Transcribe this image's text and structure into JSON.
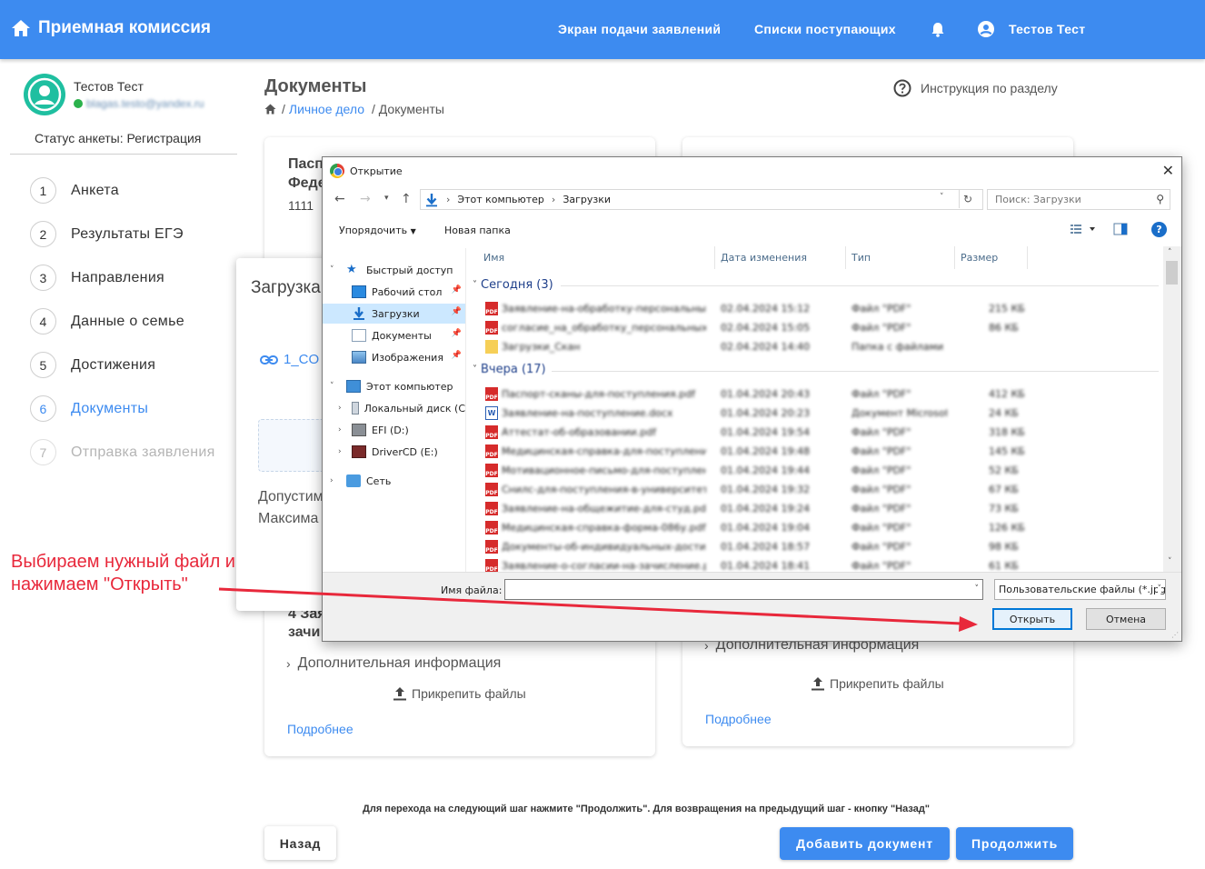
{
  "header": {
    "brand": "Приемная комиссия",
    "nav": [
      "Экран подачи заявлений",
      "Списки поступающих"
    ],
    "user": "Тестов Тест"
  },
  "sidebar": {
    "user_name": "Тестов Тест",
    "user_email": "blagas.testo@yandex.ru",
    "status": "Статус анкеты: Регистрация",
    "steps": [
      {
        "num": "1",
        "label": "Анкета"
      },
      {
        "num": "2",
        "label": "Результаты ЕГЭ"
      },
      {
        "num": "3",
        "label": "Направления"
      },
      {
        "num": "4",
        "label": "Данные о семье"
      },
      {
        "num": "5",
        "label": "Достижения"
      },
      {
        "num": "6",
        "label": "Документы"
      },
      {
        "num": "7",
        "label": "Отправка заявления"
      }
    ]
  },
  "main": {
    "title": "Документы",
    "breadcrumb": {
      "link": "Личное дело",
      "current": "/ Документы"
    },
    "instruction": "Инструкция по разделу",
    "card1": {
      "title_line1": "Пасп",
      "title_line2": "Феде",
      "number": "1111",
      "footer_line1": "4 Зая",
      "footer_line2": "зачи",
      "additional": "Дополнительная информация",
      "attach": "Прикрепить файлы",
      "more": "Подробнее"
    },
    "card2": {
      "additional": "Дополнительная информация",
      "attach": "Прикрепить файлы",
      "more": "Подробнее"
    }
  },
  "upload_modal": {
    "title": "Загрузка",
    "link": "1_CO",
    "line1": "Допустим",
    "line2": "Максима"
  },
  "footer": {
    "note": "Для перехода на следующий шаг нажмите \"Продолжить\". Для возвращения на предыдущий шаг - кнопку \"Назад\"",
    "back": "Назад",
    "add": "Добавить документ",
    "next": "Продолжить"
  },
  "file_dialog": {
    "title": "Открытие",
    "path": [
      "Этот компьютер",
      "Загрузки"
    ],
    "search_placeholder": "Поиск: Загрузки",
    "organize": "Упорядочить",
    "new_folder": "Новая папка",
    "tree": [
      {
        "label": "Быстрый доступ"
      },
      {
        "label": "Рабочий стол"
      },
      {
        "label": "Загрузки"
      },
      {
        "label": "Документы"
      },
      {
        "label": "Изображения"
      },
      {
        "label": "Этот компьютер"
      },
      {
        "label": "Локальный диск (C"
      },
      {
        "label": "EFI (D:)"
      },
      {
        "label": "DriverCD (E:)"
      },
      {
        "label": "Сеть"
      }
    ],
    "columns": [
      "Имя",
      "Дата изменения",
      "Тип",
      "Размер"
    ],
    "groups": [
      "Сегодня (3)",
      "Вчера (17)"
    ],
    "files_today": [
      {
        "icon": "pdf",
        "name": "Заявление-на-обработку-персональных-данных.pdf",
        "date": "02.04.2024 15:12",
        "type": "Файл \"PDF\"",
        "size": "215 КБ"
      },
      {
        "icon": "pdf",
        "name": "согласие_на_обработку_персональных_данных.pdf",
        "date": "02.04.2024 15:05",
        "type": "Файл \"PDF\"",
        "size": "86 КБ"
      },
      {
        "icon": "folder",
        "name": "Загрузки_Скан",
        "date": "02.04.2024 14:40",
        "type": "Папка с файлами",
        "size": ""
      }
    ],
    "files_yesterday": [
      {
        "icon": "pdf",
        "name": "Паспорт-сканы-для-поступления.pdf",
        "date": "01.04.2024 20:43",
        "type": "Файл \"PDF\"",
        "size": "412 КБ"
      },
      {
        "icon": "word",
        "name": "Заявление-на-поступление.docx",
        "date": "01.04.2024 20:23",
        "type": "Документ Microsoft Word",
        "size": "24 КБ"
      },
      {
        "icon": "pdf",
        "name": "Аттестат-об-образовании.pdf",
        "date": "01.04.2024 19:54",
        "type": "Файл \"PDF\"",
        "size": "318 КБ"
      },
      {
        "icon": "pdf",
        "name": "Медицинская-справка-для-поступления-в-вуз.pdf",
        "date": "01.04.2024 19:48",
        "type": "Файл \"PDF\"",
        "size": "145 КБ"
      },
      {
        "icon": "pdf",
        "name": "Мотивационное-письмо-для-поступления.pdf",
        "date": "01.04.2024 19:44",
        "type": "Файл \"PDF\"",
        "size": "52 КБ"
      },
      {
        "icon": "pdf",
        "name": "Снилс-для-поступления-в-университет.pdf",
        "date": "01.04.2024 19:32",
        "type": "Файл \"PDF\"",
        "size": "67 КБ"
      },
      {
        "icon": "pdf",
        "name": "Заявление-на-общежитие-для-студ.pdf",
        "date": "01.04.2024 19:24",
        "type": "Файл \"PDF\"",
        "size": "73 КБ"
      },
      {
        "icon": "pdf",
        "name": "Медицинская-справка-форма-086у.pdf",
        "date": "01.04.2024 19:04",
        "type": "Файл \"PDF\"",
        "size": "126 КБ"
      },
      {
        "icon": "pdf",
        "name": "Документы-об-индивидуальных-достижениях.pdf",
        "date": "01.04.2024 18:57",
        "type": "Файл \"PDF\"",
        "size": "98 КБ"
      },
      {
        "icon": "pdf",
        "name": "Заявление-о-согласии-на-зачисление.pdf",
        "date": "01.04.2024 18:41",
        "type": "Файл \"PDF\"",
        "size": "61 КБ"
      }
    ],
    "filename_label": "Имя файла:",
    "filename_value": "",
    "filetype": "Пользовательские файлы (*.jpg",
    "open": "Открыть",
    "cancel": "Отмена"
  },
  "annotation": {
    "line1": "Выбираем нужный файл и",
    "line2": "нажимаем \"Открыть\""
  },
  "colors": {
    "accent": "#3d8bf0",
    "annotation": "#e8283b",
    "avatar": "#1fbfa0"
  }
}
